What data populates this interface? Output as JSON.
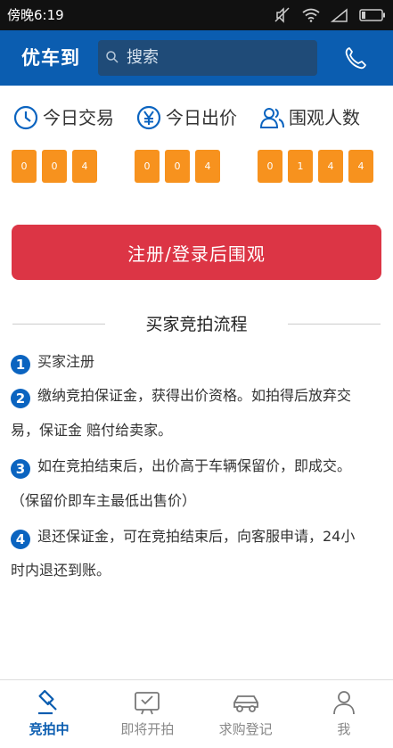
{
  "status_bar": {
    "time": "傍晚6:19"
  },
  "header": {
    "title": "优车到",
    "search_placeholder": "搜索"
  },
  "stats": [
    {
      "label": "今日交易",
      "icon": "clock-icon",
      "digits": [
        "0",
        "0",
        "4"
      ]
    },
    {
      "label": "今日出价",
      "icon": "yuan-icon",
      "digits": [
        "0",
        "0",
        "4"
      ]
    },
    {
      "label": "围观人数",
      "icon": "people-icon",
      "digits": [
        "0",
        "1",
        "4",
        "4"
      ]
    }
  ],
  "register_button": "注册/登录后围观",
  "process": {
    "title": "买家竞拍流程",
    "steps": [
      {
        "num": "1",
        "text": "买家注册"
      },
      {
        "num": "2",
        "line1": "缴纳竞拍保证金，获得出价资格。如拍得后放弃交",
        "line2": "易，保证金 赔付给卖家。"
      },
      {
        "num": "3",
        "line1": "如在竞拍结束后，出价高于车辆保留价，即成交。",
        "line2": "（保留价即车主最低出售价）"
      },
      {
        "num": "4",
        "line1": "退还保证金，可在竞拍结束后，向客服申请，24小",
        "line2": "时内退还到账。"
      }
    ]
  },
  "tabs": [
    {
      "label": "竞拍中",
      "icon": "gavel-icon",
      "active": true
    },
    {
      "label": "即将开拍",
      "icon": "calendar-check-icon",
      "active": false
    },
    {
      "label": "求购登记",
      "icon": "car-icon",
      "active": false
    },
    {
      "label": "我",
      "icon": "user-icon",
      "active": false
    }
  ],
  "colors": {
    "header": "#0b5db0",
    "accent_orange": "#f7921e",
    "register_red": "#dc3545",
    "badge_blue": "#0b64c0"
  }
}
